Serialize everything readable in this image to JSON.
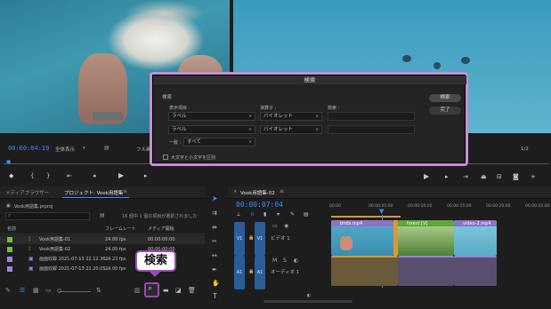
{
  "source_monitor": {
    "timecode": "00:00:04:19",
    "zoom": "全体表示",
    "quality": "フル画質"
  },
  "program_monitor": {
    "ratio": "1/2"
  },
  "search_dialog": {
    "title": "検索",
    "section_label": "検索",
    "col_display": "表示項目 :",
    "col_operator": "演算子 :",
    "col_find": "検索 :",
    "row1_display": "ラベル",
    "row1_operator": "バイオレット",
    "row2_display": "ラベル",
    "row2_operator": "バイオレット",
    "match_label": "一致 :",
    "match_value": "すべて",
    "case_label": "大文字と小文字を区別",
    "find_button": "検索",
    "done_button": "完了"
  },
  "project_panel": {
    "tab_media_browser": "メディアブラウザー",
    "tab_project": "プロジェクト: Vook用語集",
    "project_file": "Vook用語集.prproj",
    "selection_status": "16 個中 1 個の項目が選択されました",
    "col_name": "名前",
    "col_framerate": "フレームレート",
    "col_media_start": "メディア開始",
    "items": [
      {
        "name": "Vook用語集-01",
        "fps": "24.00 fps",
        "start": "00:00:00:00",
        "color": "#6dbf4a",
        "kind": "sequence"
      },
      {
        "name": "Vook用語集-02",
        "fps": "24.00 fps",
        "start": "00:00:00:00",
        "color": "#6dbf4a",
        "kind": "sequence"
      },
      {
        "name": "画面収録 2021-07-13 22.12.36...",
        "fps": "24.23 fps",
        "start": "",
        "color": "#9c83d8",
        "kind": "clip"
      },
      {
        "name": "画面収録 2021-07-13 22.20.05...",
        "fps": "24.00 fps",
        "start": "",
        "color": "#9c83d8",
        "kind": "clip"
      }
    ]
  },
  "callout": {
    "label": "検索"
  },
  "timeline": {
    "tab": "Vook用語集-02",
    "timecode": "00:00:07:04",
    "ruler": [
      "00:00",
      "00:00:05:00",
      "00:00:10:00",
      "00:00:15:00",
      "00:00:20:00",
      "00:00:25:00"
    ],
    "tracks": {
      "v1_src": "V1",
      "v1": "V1",
      "v1_name": "ビデオ 1",
      "a1_src": "A1",
      "a1": "A1",
      "a1_name": "オーディオ 1"
    },
    "clips": [
      {
        "name": "birds.mp4"
      },
      {
        "name": "forest [V]"
      },
      {
        "name": "video-2.mp4"
      }
    ]
  },
  "colors": {
    "accent_blue": "#3c8cff",
    "dialog_outline": "#c78fd1",
    "callout_border": "#9b4ab3",
    "clip_violet": "#9c83d8",
    "clip_green": "#6dbf4a",
    "clip_orange": "#d69a36",
    "audio_tan": "#6b5a3a"
  }
}
